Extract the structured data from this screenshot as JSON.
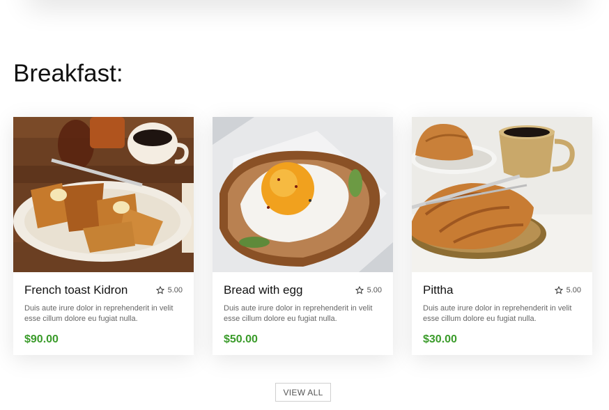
{
  "section": {
    "heading": "Breakfast:"
  },
  "items": [
    {
      "name": "French toast Kidron",
      "rating": "5.00",
      "description": "Duis aute irure dolor in reprehenderit in velit esse cillum dolore eu fugiat nulla.",
      "price": "$90.00",
      "image": "french-toast-photo"
    },
    {
      "name": "Bread with egg",
      "rating": "5.00",
      "description": "Duis aute irure dolor in reprehenderit in velit esse cillum dolore eu fugiat nulla.",
      "price": "$50.00",
      "image": "egg-toast-photo"
    },
    {
      "name": "Pittha",
      "rating": "5.00",
      "description": "Duis aute irure dolor in reprehenderit in velit esse cillum dolore eu fugiat nulla.",
      "price": "$30.00",
      "image": "croissant-photo"
    }
  ],
  "view_all_label": "VIEW ALL",
  "colors": {
    "price": "#3a9b2a",
    "heading": "#111111"
  },
  "icons": {
    "rating": "star-outline-icon"
  }
}
